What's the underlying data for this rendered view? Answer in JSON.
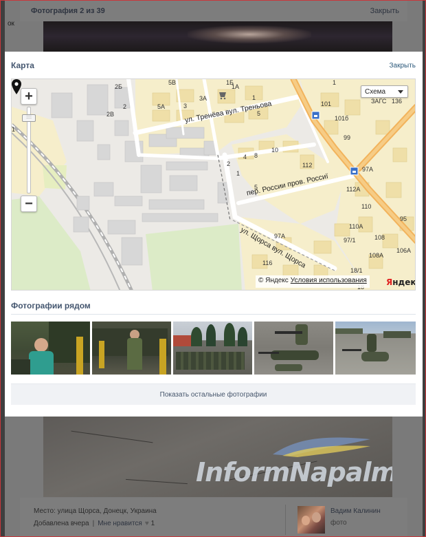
{
  "viewer": {
    "title": "Фотография 2 из 39",
    "close_label": "Закрыть",
    "left_stub": "ок",
    "watermark": "InformNapalm",
    "place": "Место: улица Щорса, Донецк, Украина",
    "added": "Добавлена вчера",
    "like_label": "Мне нравится",
    "like_icon": "heart-icon",
    "like_count": "1",
    "author_name": "Вадим Калинин",
    "author_type": "фото"
  },
  "modal": {
    "title": "Карта",
    "close_label": "Закрыть"
  },
  "map": {
    "map_type": "Схема",
    "copyright": "© Яндекс",
    "terms_label": "Условия использования",
    "logo_first": "Я",
    "logo_rest": "ндекс",
    "zoom_in": "+",
    "zoom_out": "−",
    "handle_glyph": "::::",
    "pin_icon": "location-pin-icon",
    "streets": {
      "treneva": "ул. Тренёва вул. Треньова",
      "rossii": "пер. России пров. Россиї",
      "shchorsa": "ул. Щорса вул. Щорса"
    },
    "labels": [
      {
        "text": "2Б",
        "name": "house-2b-label"
      },
      {
        "text": "5В",
        "name": "house-5v-label"
      },
      {
        "text": "1Б",
        "name": "house-1b-label"
      },
      {
        "text": "5А",
        "name": "house-5a-label"
      },
      {
        "text": "2",
        "name": "house-2-label"
      },
      {
        "text": "2В",
        "name": "house-2v-label"
      },
      {
        "text": "3",
        "name": "house-3-label"
      },
      {
        "text": "3А",
        "name": "house-3a-label"
      },
      {
        "text": "1А",
        "name": "house-1a-label"
      },
      {
        "text": "1",
        "name": "house-1-label"
      },
      {
        "text": "5",
        "name": "house-5-label"
      },
      {
        "text": "1",
        "name": "house-1-treneva-label"
      },
      {
        "text": "2",
        "name": "house-2-east-label"
      },
      {
        "text": "4",
        "name": "house-4-label"
      },
      {
        "text": "8",
        "name": "house-8-label"
      },
      {
        "text": "10",
        "name": "house-10-label"
      },
      {
        "text": "112",
        "name": "house-112-label"
      },
      {
        "text": "1",
        "name": "house-1-rossii-label"
      },
      {
        "text": "5",
        "name": "house-5-rossii-label"
      },
      {
        "text": "101",
        "name": "house-101-label"
      },
      {
        "text": "101б",
        "name": "house-101b-label"
      },
      {
        "text": "99",
        "name": "house-99-label"
      },
      {
        "text": "ЗАГС",
        "name": "zags-label"
      },
      {
        "text": "136",
        "name": "house-136-label"
      },
      {
        "text": "97А",
        "name": "house-97a-label"
      },
      {
        "text": "112А",
        "name": "house-112a-label"
      },
      {
        "text": "110",
        "name": "house-110-label"
      },
      {
        "text": "97А",
        "name": "house-97a-shchorsa-label"
      },
      {
        "text": "97/1",
        "name": "house-97-1-label"
      },
      {
        "text": "116",
        "name": "house-116-label"
      },
      {
        "text": "18/1",
        "name": "house-18-1-label"
      },
      {
        "text": "18",
        "name": "house-18-label"
      },
      {
        "text": "110А",
        "name": "house-110a-label"
      },
      {
        "text": "108",
        "name": "house-108-label"
      },
      {
        "text": "108А",
        "name": "house-108a-label"
      },
      {
        "text": "106А",
        "name": "house-106a-label"
      },
      {
        "text": "95",
        "name": "house-95-label"
      },
      {
        "text": "1",
        "name": "house-1-upper-label"
      }
    ]
  },
  "nearby": {
    "title": "Фотографии рядом",
    "show_more": "Показать остальные фотографии"
  }
}
